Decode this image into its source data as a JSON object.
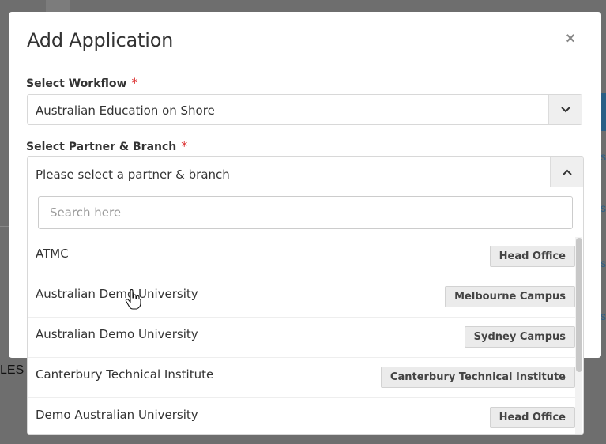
{
  "modal": {
    "title": "Add Application",
    "close_glyph": "×"
  },
  "workflow": {
    "label": "Select Workflow",
    "required_mark": "*",
    "value": "Australian Education on Shore"
  },
  "partner": {
    "label": "Select Partner & Branch",
    "required_mark": "*",
    "placeholder": "Please select a partner & branch",
    "search_placeholder": "Search here",
    "options": [
      {
        "name": "ATMC",
        "branch": "Head Office"
      },
      {
        "name": "Australian Demo University",
        "branch": "Melbourne Campus"
      },
      {
        "name": "Australian Demo University",
        "branch": "Sydney Campus"
      },
      {
        "name": "Canterbury Technical Institute",
        "branch": "Canterbury Technical Institute"
      },
      {
        "name": "Demo Australian University",
        "branch": "Head Office"
      }
    ]
  },
  "background": {
    "fragment_text": "LES",
    "link_fragment": "s"
  },
  "icons": {
    "close": "close-icon",
    "chevron_down": "chevron-down-icon",
    "chevron_up": "chevron-up-icon",
    "cursor": "hand-pointer-icon"
  }
}
